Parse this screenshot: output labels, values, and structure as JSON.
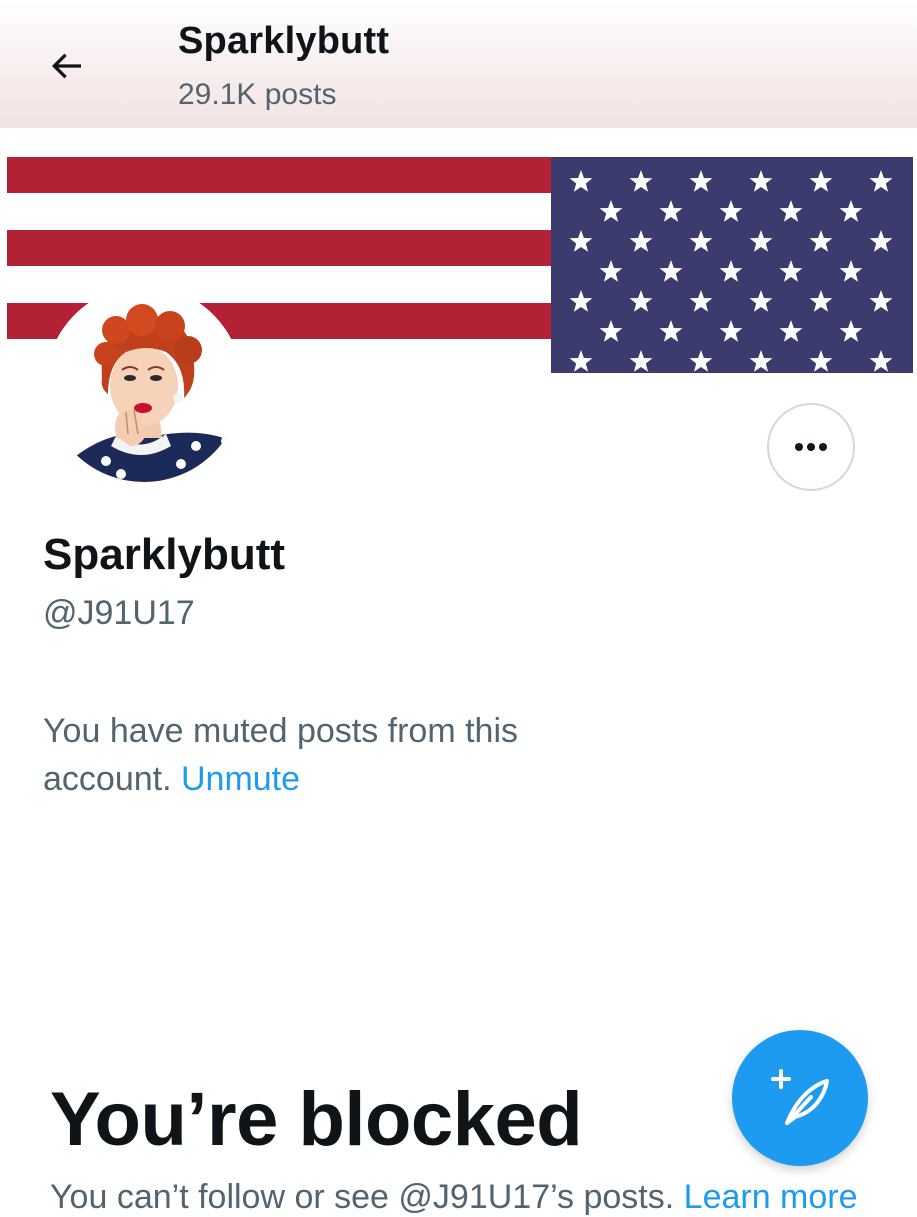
{
  "header": {
    "name": "Sparklybutt",
    "post_count": "29.1K posts"
  },
  "profile": {
    "display_name": "Sparklybutt",
    "handle": "@J91U17",
    "muted_notice": "You have muted posts from this account.",
    "unmute_label": "Unmute"
  },
  "blocked": {
    "title": "You’re blocked",
    "description": "You can’t follow or see @J91U17’s posts. ",
    "learn_more": "Learn more"
  },
  "icons": {
    "back": "back-arrow-icon",
    "more": "more-horizontal-icon",
    "compose": "compose-post-icon"
  },
  "colors": {
    "accent": "#1d9bf0",
    "flag_red": "#b22234",
    "flag_blue": "#3c3b6e",
    "secondary_text": "#536471"
  }
}
